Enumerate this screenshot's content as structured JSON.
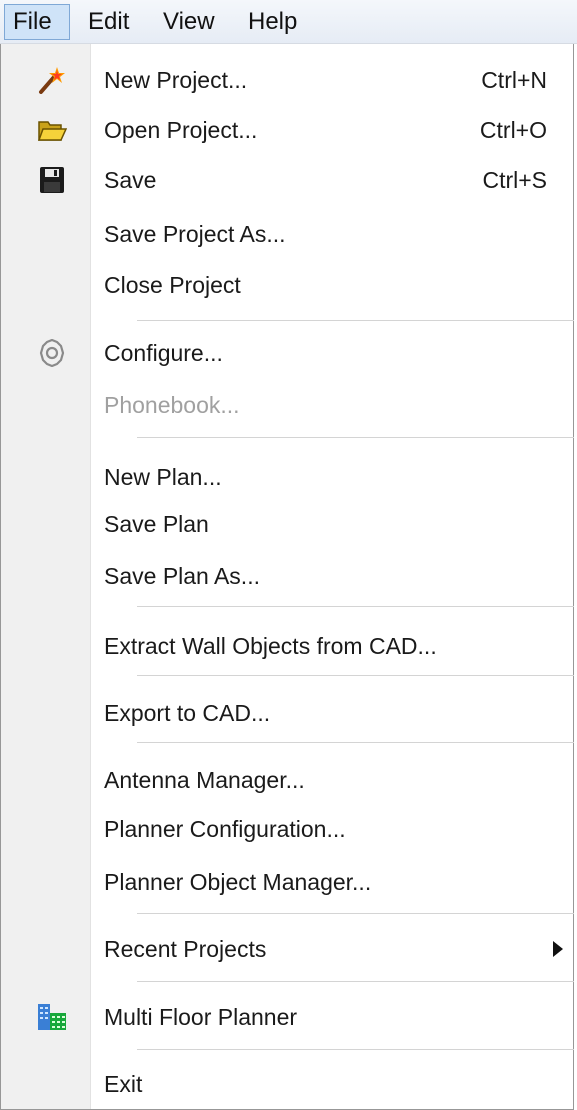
{
  "menubar": {
    "items": [
      {
        "label": "File",
        "active": true
      },
      {
        "label": "Edit"
      },
      {
        "label": "View"
      },
      {
        "label": "Help"
      }
    ]
  },
  "menu": {
    "new_project": {
      "label": "New Project...",
      "shortcut": "Ctrl+N",
      "icon": "magic-wand-icon"
    },
    "open_project": {
      "label": "Open Project...",
      "shortcut": "Ctrl+O",
      "icon": "open-folder-icon"
    },
    "save": {
      "label": "Save",
      "shortcut": "Ctrl+S",
      "icon": "floppy-disk-icon"
    },
    "save_project_as": {
      "label": "Save Project As..."
    },
    "close_project": {
      "label": "Close Project"
    },
    "configure": {
      "label": "Configure...",
      "icon": "gear-icon"
    },
    "phonebook": {
      "label": "Phonebook...",
      "disabled": true
    },
    "new_plan": {
      "label": "New Plan..."
    },
    "save_plan": {
      "label": "Save Plan"
    },
    "save_plan_as": {
      "label": "Save Plan As..."
    },
    "extract_wall": {
      "label": "Extract Wall Objects from CAD..."
    },
    "export_cad": {
      "label": "Export to CAD..."
    },
    "antenna_manager": {
      "label": "Antenna Manager..."
    },
    "planner_configuration": {
      "label": "Planner Configuration..."
    },
    "planner_object_manager": {
      "label": "Planner Object Manager..."
    },
    "recent_projects": {
      "label": "Recent Projects",
      "submenu": true
    },
    "multi_floor_planner": {
      "label": "Multi Floor Planner",
      "icon": "buildings-icon"
    },
    "exit": {
      "label": "Exit"
    }
  },
  "colors": {
    "menubar_active_bg": "#cfe3f8",
    "gutter_bg": "#f0f0f0",
    "disabled_text": "#a0a0a0"
  }
}
